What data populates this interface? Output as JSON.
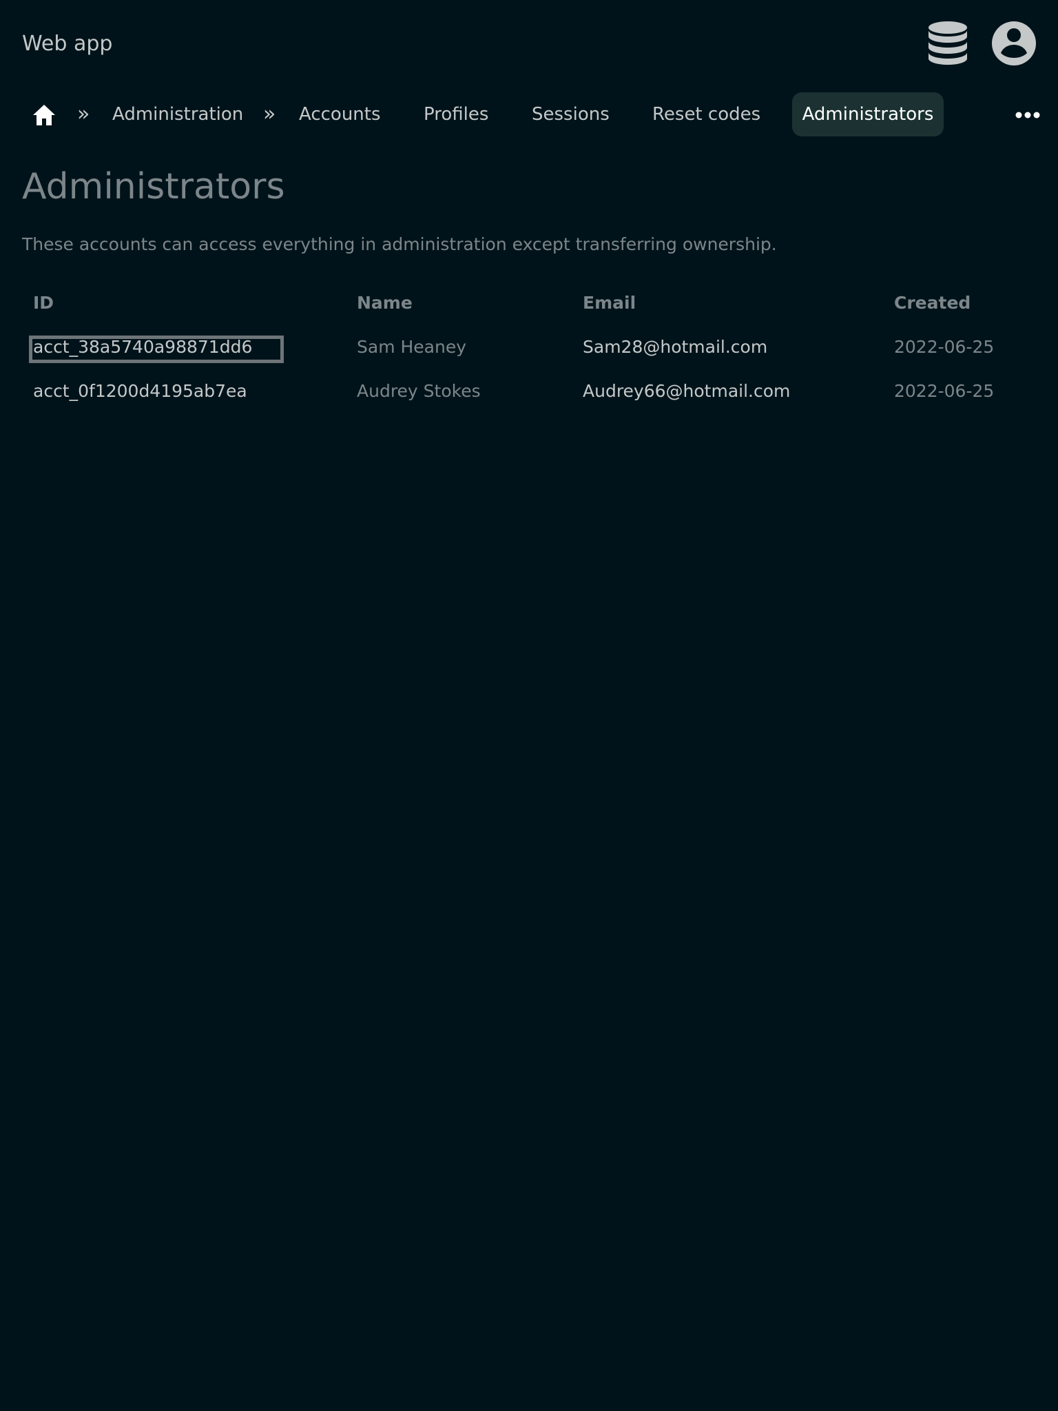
{
  "header": {
    "app_title": "Web app",
    "icons": [
      "database-icon",
      "account-circle-icon"
    ]
  },
  "breadcrumb": {
    "home_icon": "home-icon",
    "separator": "»",
    "items": [
      {
        "label": "Administration"
      },
      {
        "label": "Accounts"
      },
      {
        "label": "Profiles"
      },
      {
        "label": "Sessions"
      },
      {
        "label": "Reset codes"
      },
      {
        "label": "Administrators",
        "active": true
      }
    ],
    "more_icon": "more-horizontal-icon"
  },
  "main": {
    "title": "Administrators",
    "description": "These accounts can access everything in administration except transferring ownership."
  },
  "table": {
    "columns": [
      "ID",
      "Name",
      "Email",
      "Created"
    ],
    "rows": [
      {
        "id": "acct_38a5740a98871dd6",
        "name": "Sam Heaney",
        "email": "Sam28@hotmail.com",
        "created": "2022-06-25",
        "focused": true
      },
      {
        "id": "acct_0f1200d4195ab7ea",
        "name": "Audrey Stokes",
        "email": "Audrey66@hotmail.com",
        "created": "2022-06-25"
      }
    ]
  },
  "colors": {
    "background": "#01131a",
    "active_tab_bg": "#1c3232",
    "text_primary": "#c4c8c9",
    "text_muted": "#7c868a"
  }
}
